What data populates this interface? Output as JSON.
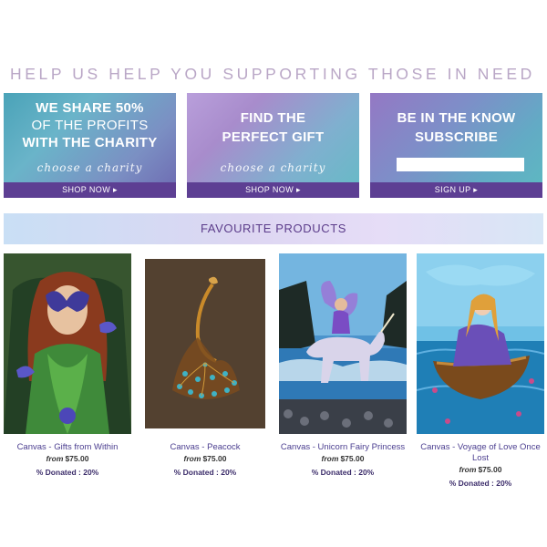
{
  "headline": "HELP US HELP YOU SUPPORTING THOSE IN NEED",
  "promos": [
    {
      "title_lines": [
        "WE SHARE 50%",
        "OF THE PROFITS",
        "WITH THE CHARITY"
      ],
      "script": "choose a charity",
      "button": "SHOP NOW ▸"
    },
    {
      "title_lines": [
        "FIND THE",
        "PERFECT GIFT"
      ],
      "script": "choose a charity",
      "button": "SHOP NOW ▸"
    },
    {
      "title_lines": [
        "BE IN THE KNOW",
        "SUBSCRIBE"
      ],
      "button": "SIGN UP ▸"
    }
  ],
  "favourites_title": "FAVOURITE PRODUCTS",
  "products": [
    {
      "name": "Canvas - Gifts from Within",
      "from_label": "from",
      "price": "$75.00",
      "donated": "% Donated : 20%",
      "image_icon": "butterfly-masked-woman-painting"
    },
    {
      "name": "Canvas - Peacock",
      "from_label": "from",
      "price": "$75.00",
      "donated": "% Donated : 20%",
      "image_icon": "peacock-painting"
    },
    {
      "name": "Canvas - Unicorn Fairy Princess",
      "from_label": "from",
      "price": "$75.00",
      "donated": "% Donated : 20%",
      "image_icon": "unicorn-fairy-painting"
    },
    {
      "name": "Canvas - Voyage of Love Once Lost",
      "from_label": "from",
      "price": "$75.00",
      "donated": "% Donated : 20%",
      "image_icon": "girl-in-boat-painting"
    }
  ],
  "colors": {
    "headline": "#b9a6c6",
    "button_bar": "#5d3f93",
    "product_name": "#4a3d8f",
    "favourites_text": "#5b3c8a"
  }
}
